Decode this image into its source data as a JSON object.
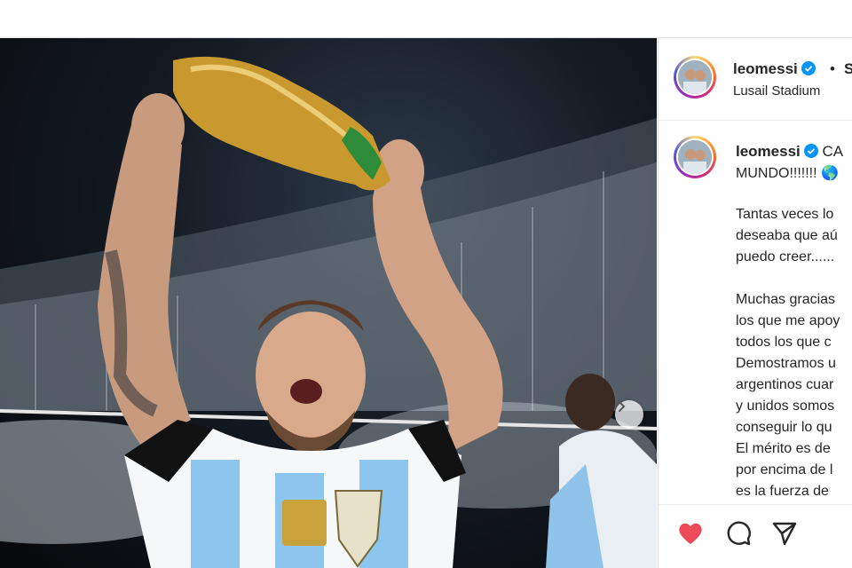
{
  "post": {
    "username": "leomessi",
    "follow_dot": "•",
    "follow_label": "S",
    "location": "Lusail Stadium"
  },
  "caption": {
    "username": "leomessi",
    "head_text": "CA",
    "line2": "MUNDO!!!!!!! 🌎",
    "lines": [
      "Tantas veces lo",
      "deseaba que aú",
      "puedo creer......",
      "",
      "Muchas gracias",
      "los que me apoy",
      "todos los que c",
      "Demostramos u",
      "argentinos cuar",
      "y unidos somos",
      "conseguir lo qu",
      "El mérito es de",
      "por encima de l",
      "es la fuerza de"
    ]
  },
  "colors": {
    "like": "#ed4956",
    "verified": "#0095f6",
    "text": "#262626"
  },
  "icons": {
    "like": "heart-icon",
    "comment": "comment-icon",
    "share": "send-icon",
    "next": "chevron-right-icon",
    "verified": "verified-badge-icon"
  }
}
